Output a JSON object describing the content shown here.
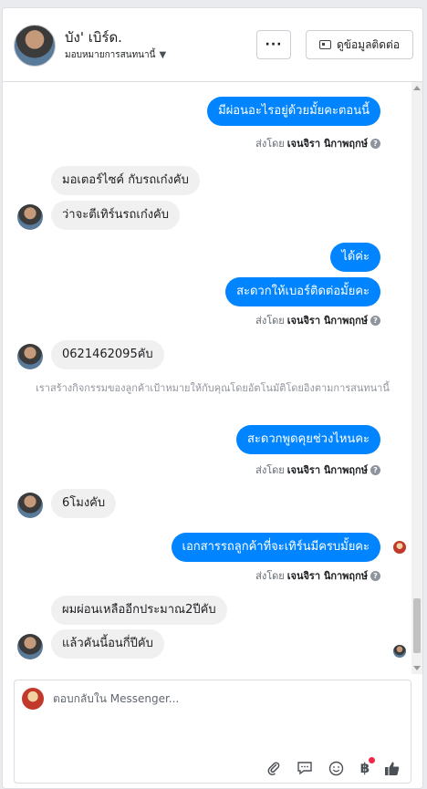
{
  "header": {
    "name": "บัง' เบิร์ด.",
    "subtitle": "มอบหมายการสนทนานี้",
    "more_label": "···",
    "contact_label": "ดูข้อมูลติดต่อ"
  },
  "messages": [
    {
      "type": "out",
      "text": "มีผ่อนอะไรอยู่ด้วยมั้ยคะตอนนี้"
    },
    {
      "type": "sent_by",
      "prefix": "ส่งโดย",
      "name": "เจนจิรา นิกาพฤกษ์"
    },
    {
      "type": "in",
      "text": "มอเตอร์ไซค์ กับรถเก๋งคับ"
    },
    {
      "type": "in",
      "text": "ว่าจะตีเทิร์นรถเก๋งคับ"
    },
    {
      "type": "out",
      "text": "ได้ค่ะ"
    },
    {
      "type": "out",
      "text": "สะดวกให้เบอร์ติดต่อมั้ยคะ"
    },
    {
      "type": "sent_by",
      "prefix": "ส่งโดย",
      "name": "เจนจิรา นิกาพฤกษ์"
    },
    {
      "type": "in",
      "text": "0621462095คับ"
    },
    {
      "type": "system",
      "text": "เราสร้างกิจกรรมของลูกค้าเป้าหมายให้กับคุณโดยอัตโนมัติโดยอิงตามการสนทนานี้"
    },
    {
      "type": "out",
      "text": "สะดวกพูดคุยช่วงไหนคะ"
    },
    {
      "type": "sent_by",
      "prefix": "ส่งโดย",
      "name": "เจนจิรา นิกาพฤกษ์"
    },
    {
      "type": "in",
      "text": "6โมงคับ"
    },
    {
      "type": "out",
      "text": "เอกสารรถลูกค้าที่จะเทิร์นมีครบมั้ยคะ"
    },
    {
      "type": "sent_by",
      "prefix": "ส่งโดย",
      "name": "เจนจิรา นิกาพฤกษ์"
    },
    {
      "type": "in",
      "text": "ผมผ่อนเหลืออีกประมาณ2ปีคับ"
    },
    {
      "type": "in",
      "text": "แล้วคันนี้อนกี่ปีคับ"
    }
  ],
  "composer": {
    "placeholder": "ตอบกลับใน Messenger..."
  },
  "icons": {
    "attach": "paperclip-icon",
    "saved_replies": "chat-bubble-icon",
    "emoji": "smiley-icon",
    "payment": "baht-icon",
    "like": "thumbs-up-icon"
  },
  "colors": {
    "outgoing_bubble": "#0084ff",
    "incoming_bubble": "#f1f0f0",
    "badge": "#f02849"
  }
}
